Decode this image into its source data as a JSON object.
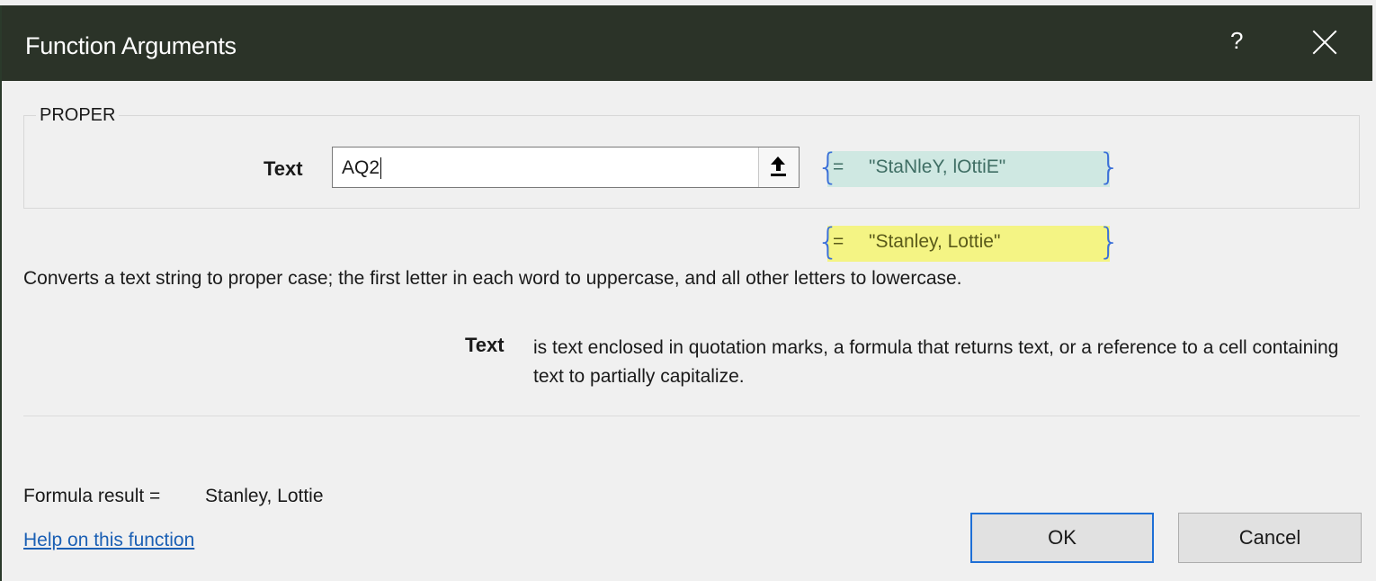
{
  "window": {
    "title": "Function Arguments",
    "help_glyph": "?",
    "close_icon": "close-icon"
  },
  "function_group": {
    "name": "PROPER",
    "argument": {
      "label": "Text",
      "value": "AQ2",
      "evaluated_eq": "=",
      "evaluated_value": "\"StaNleY, lOttiE\""
    },
    "result_eq": "=",
    "result_value": "\"Stanley, Lottie\""
  },
  "description": "Converts a text string to proper case; the first letter in each word to uppercase, and all other letters to lowercase.",
  "argument_help": {
    "name": "Text",
    "text": "is text enclosed in quotation marks, a formula that returns text, or a reference to a cell containing text to partially capitalize."
  },
  "formula_result": {
    "label": "Formula result =",
    "value": "Stanley, Lottie"
  },
  "help_link": "Help on this function",
  "buttons": {
    "ok": "OK",
    "cancel": "Cancel"
  },
  "colors": {
    "titlebar": "#2b3328",
    "current_value_bg": "#cfe8e2",
    "result_value_bg": "#f4f484",
    "link": "#1a5fb4",
    "ok_border": "#1e6fd6"
  }
}
